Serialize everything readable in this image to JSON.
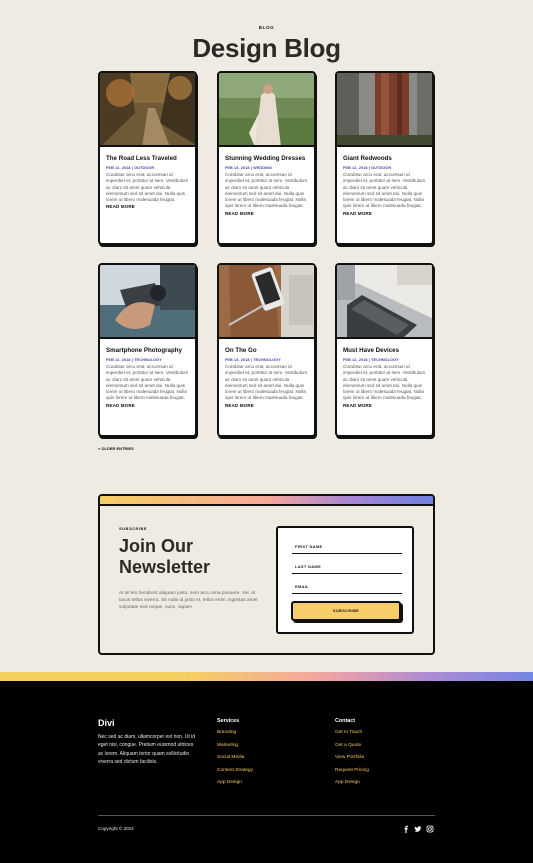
{
  "header": {
    "kicker": "BLOG",
    "title": "Design Blog"
  },
  "posts": [
    {
      "title": "The Road Less Traveled",
      "meta": "FEB 12, 2018 | OUTDOOR",
      "excerpt": "Curabitur arcu erat, accumsan id imperdiet et, porttitor at sem. Vestibulum ac diam sit amet quam vehicula elementum sed sit amet dui. Nulla quis lorem ut libero malesuada feugiat.",
      "more": "READ MORE",
      "image": "forest-road-photo"
    },
    {
      "title": "Stunning Wedding Dresses",
      "meta": "FEB 13, 2018 | WEDDING",
      "excerpt": "Curabitur arcu erat, accumsan id imperdiet et, porttitor at sem. Vestibulum ac diam sit amet quam vehicula elementum sed sit amet dui. Nulla quis lorem ut libero malesuada feugiat. Nulla quis lorem ut libero malesuada feugiat.",
      "more": "READ MORE",
      "image": "bride-photo"
    },
    {
      "title": "Giant Redwoods",
      "meta": "FEB 12, 2018 | OUTDOOR",
      "excerpt": "Curabitur arcu erat, accumsan id imperdiet et, porttitor at sem. Vestibulum ac diam sit amet quam vehicula elementum sed sit amet dui. Nulla quis lorem ut libero malesuada feugiat. Nulla quis lorem ut libero malesuada feugiat.",
      "more": "READ MORE",
      "image": "redwood-photo"
    },
    {
      "title": "Smartphone Photography",
      "meta": "FEB 12, 2018 | TECHNOLOGY",
      "excerpt": "Curabitur arcu erat, accumsan id imperdiet et, porttitor at sem. Vestibulum ac diam sit amet quam vehicula elementum sed sit amet dui. Nulla quis lorem ut libero malesuada feugiat. Nulla quis lorem ut libero malesuada feugiat.",
      "more": "READ MORE",
      "image": "binoculars-photo"
    },
    {
      "title": "On The Go",
      "meta": "FEB 13, 2018 | TECHNOLOGY",
      "excerpt": "Curabitur arcu erat, accumsan id imperdiet et, porttitor at sem. Vestibulum ac diam sit amet quam vehicula elementum sed sit amet dui. Nulla quis lorem ut libero malesuada feugiat. Nulla quis lorem ut libero malesuada feugiat.",
      "more": "READ MORE",
      "image": "phone-desk-photo"
    },
    {
      "title": "Must Have Devices",
      "meta": "FEB 12, 2018 | TECHNOLOGY",
      "excerpt": "Curabitur arcu erat, accumsan id imperdiet et, porttitor at sem. Vestibulum ac diam sit amet quam vehicula elementum sed sit amet dui. Nulla quis lorem ut libero malesuada feugiat. Nulla quis lorem ut libero malesuada feugiat.",
      "more": "READ MORE",
      "image": "laptop-photo"
    }
  ],
  "pagination": {
    "older": "« OLDER ENTRIES"
  },
  "newsletter": {
    "kicker": "SUBSCRIBE",
    "title": "Join Our Newsletter",
    "description": "At sit leo hendrerit aliquam justo, sem arcu urna posuere. Vel, et lacus tellus viverra. Sit nulla id justo et, tellus enim. Egestas amet vulputate sed neque, nunc, sapien",
    "fields": [
      "FIRST NAME",
      "LAST NAME",
      "EMAIL"
    ],
    "button": "SUBSCRIBE"
  },
  "footer": {
    "brand": "Divi",
    "description": "Nec sed ac diam, ullamcorper est non. Ut id eget nisi, congue. Pretium euismod ultrices ac lorem. Aliquam tortor quam sollicitudin viverra sed dictum facilisis.",
    "services": {
      "heading": "Services",
      "links": [
        "Branding",
        "Marketing",
        "Social Media",
        "Content Strategy",
        "App Design"
      ]
    },
    "contact": {
      "heading": "Contact",
      "links": [
        "Get In Touch",
        "Get a Quote",
        "View Portfolio",
        "Request Pricing",
        "App Design"
      ]
    },
    "copyright": "Copyright © 2022",
    "social": [
      "facebook-icon",
      "twitter-icon",
      "instagram-icon"
    ]
  },
  "colors": {
    "background": "#efebe2",
    "meta_blue": "#3b46a8",
    "button_yellow": "#f7cc6a",
    "footer_link": "#f5c96a"
  }
}
